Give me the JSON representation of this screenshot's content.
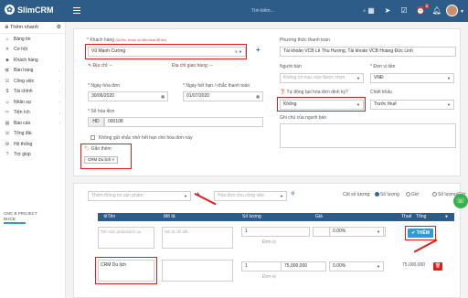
{
  "topbar": {
    "logo": "SlimCRM",
    "search_placeholder": "Tìm kiếm...",
    "notif_count": "0"
  },
  "sidebar": {
    "quick_add": "Thêm nhanh",
    "items": [
      {
        "label": "Bảng tin",
        "icon": "home-icon"
      },
      {
        "label": "Cơ hội",
        "icon": "lightbulb-icon"
      },
      {
        "label": "Khách hàng",
        "icon": "users-icon"
      },
      {
        "label": "Bán hàng",
        "icon": "cart-icon"
      },
      {
        "label": "Công việc",
        "icon": "check-icon"
      },
      {
        "label": "Tài chính",
        "icon": "money-icon"
      },
      {
        "label": "Nhân sự",
        "icon": "user-icon"
      },
      {
        "label": "Tiện ích",
        "icon": "tools-icon"
      },
      {
        "label": "Báo cáo",
        "icon": "chart-icon"
      },
      {
        "label": "Tổng đài",
        "icon": "phone-icon"
      },
      {
        "label": "Hệ thống",
        "icon": "gear-icon"
      },
      {
        "label": "Trợ giúp",
        "icon": "help-icon"
      }
    ],
    "footer_line1": "CMC B PROJECT",
    "footer_line2": "ĐHCB"
  },
  "form": {
    "customer_label": "Khách hàng",
    "customer_hint": "(Gõ tên, email, số điện thoại để tìm)",
    "customer_value": "Vũ Mạnh Cường",
    "address_label": "Địa chỉ",
    "address_value": "--",
    "ship_address_label": "Địa chỉ giao hàng",
    "ship_address_value": "--",
    "order_date_label": "Ngày hóa đơn",
    "order_date_value": "30/06/2020",
    "due_date_label": "Ngày hết hạn / nhắc thanh toán",
    "due_date_value": "01/07/2020",
    "invoice_no_label": "Số hóa đơn",
    "invoice_prefix": "HD",
    "invoice_no_value": "000108",
    "no_remind_label": "Không gửi nhắc nhở hết hạn cho hóa đơn này",
    "tags_label": "Gắn thẻm",
    "tag_value": "CRM Du lịch",
    "payment_label": "Phương thức thanh toán",
    "payment_value": "Tài khoản VCB Lê Thu Hương, Tài khoản VCB Hoàng Đức Linh",
    "seller_label": "Người bán",
    "seller_placeholder": "Không có mục nào được chọn",
    "currency_label": "Đơn vị tiền",
    "currency_value": "VNĐ",
    "auto_create_label": "Tự động tạo hóa đơn định kỳ?",
    "auto_create_value": "Không",
    "discount_label": "Chiết khấu",
    "discount_value": "Trước thuế",
    "note_label": "Ghi chú của người bán"
  },
  "items": {
    "add_product_placeholder": "Thêm thông tin sản phẩm",
    "tax_placeholder": "Hóa đơn cho công việc",
    "qty_mode_label": "Cột số lượng:",
    "qty_options": [
      "Số lượng",
      "Giờ",
      "Số lượng/Giờ"
    ],
    "columns": [
      "Tên sản phẩm",
      "Mô tả",
      "Số lượng",
      "Giá",
      "Thuế",
      "Tổng"
    ],
    "new_row": {
      "name_placeholder": "Tên sản phẩm/dịch vụ",
      "desc_placeholder": "Mô tả chi tiết",
      "qty": "1",
      "unit_placeholder": "Đơn vị",
      "price_placeholder": "Giá",
      "tax": "0.00%"
    },
    "add_button": "THÊM",
    "rows": [
      {
        "name": "CRM Du lịch",
        "qty": "1",
        "unit": "Đơn vị",
        "price": "75,000,000",
        "tax": "0.00%",
        "total": "75,000,000"
      }
    ]
  }
}
